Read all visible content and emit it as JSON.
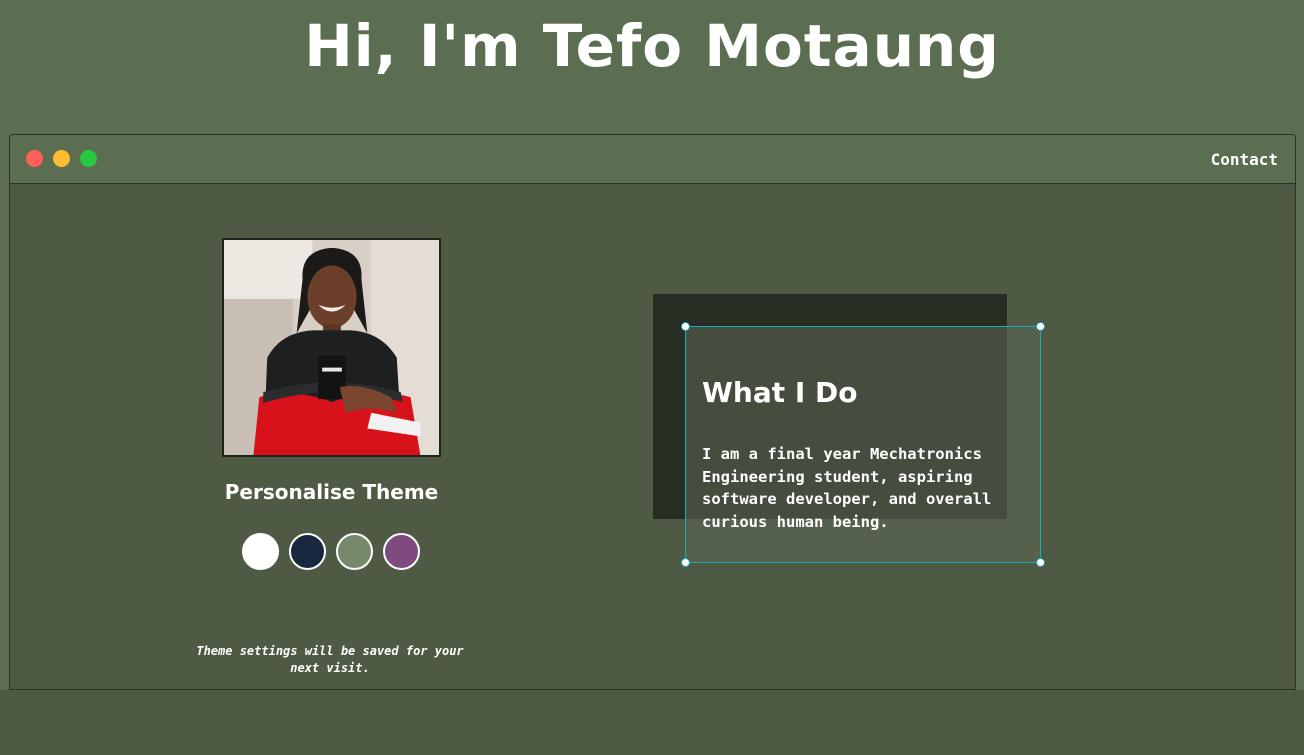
{
  "hero": {
    "title": "Hi, I'm Tefo Motaung"
  },
  "window": {
    "controls": [
      "close",
      "minimize",
      "maximize"
    ],
    "nav": {
      "contact_label": "Contact"
    }
  },
  "profile": {
    "photo_icon": "profile-photo",
    "theme_heading": "Personalise Theme",
    "theme_swatches": [
      {
        "name": "light",
        "color": "#ffffff"
      },
      {
        "name": "dark-blue",
        "color": "#17273d"
      },
      {
        "name": "green",
        "color": "#76896b"
      },
      {
        "name": "purple",
        "color": "#7f4a7f"
      }
    ],
    "theme_note": "Theme settings will be saved for your next visit."
  },
  "about": {
    "title": "What I Do",
    "text": "I am a final year Mechatronics Engineering student, aspiring software developer, and overall curious human being."
  },
  "colors": {
    "page_background": "#5b6e51",
    "window_body": "#4f5a44",
    "selection_accent": "#20a8b8"
  }
}
